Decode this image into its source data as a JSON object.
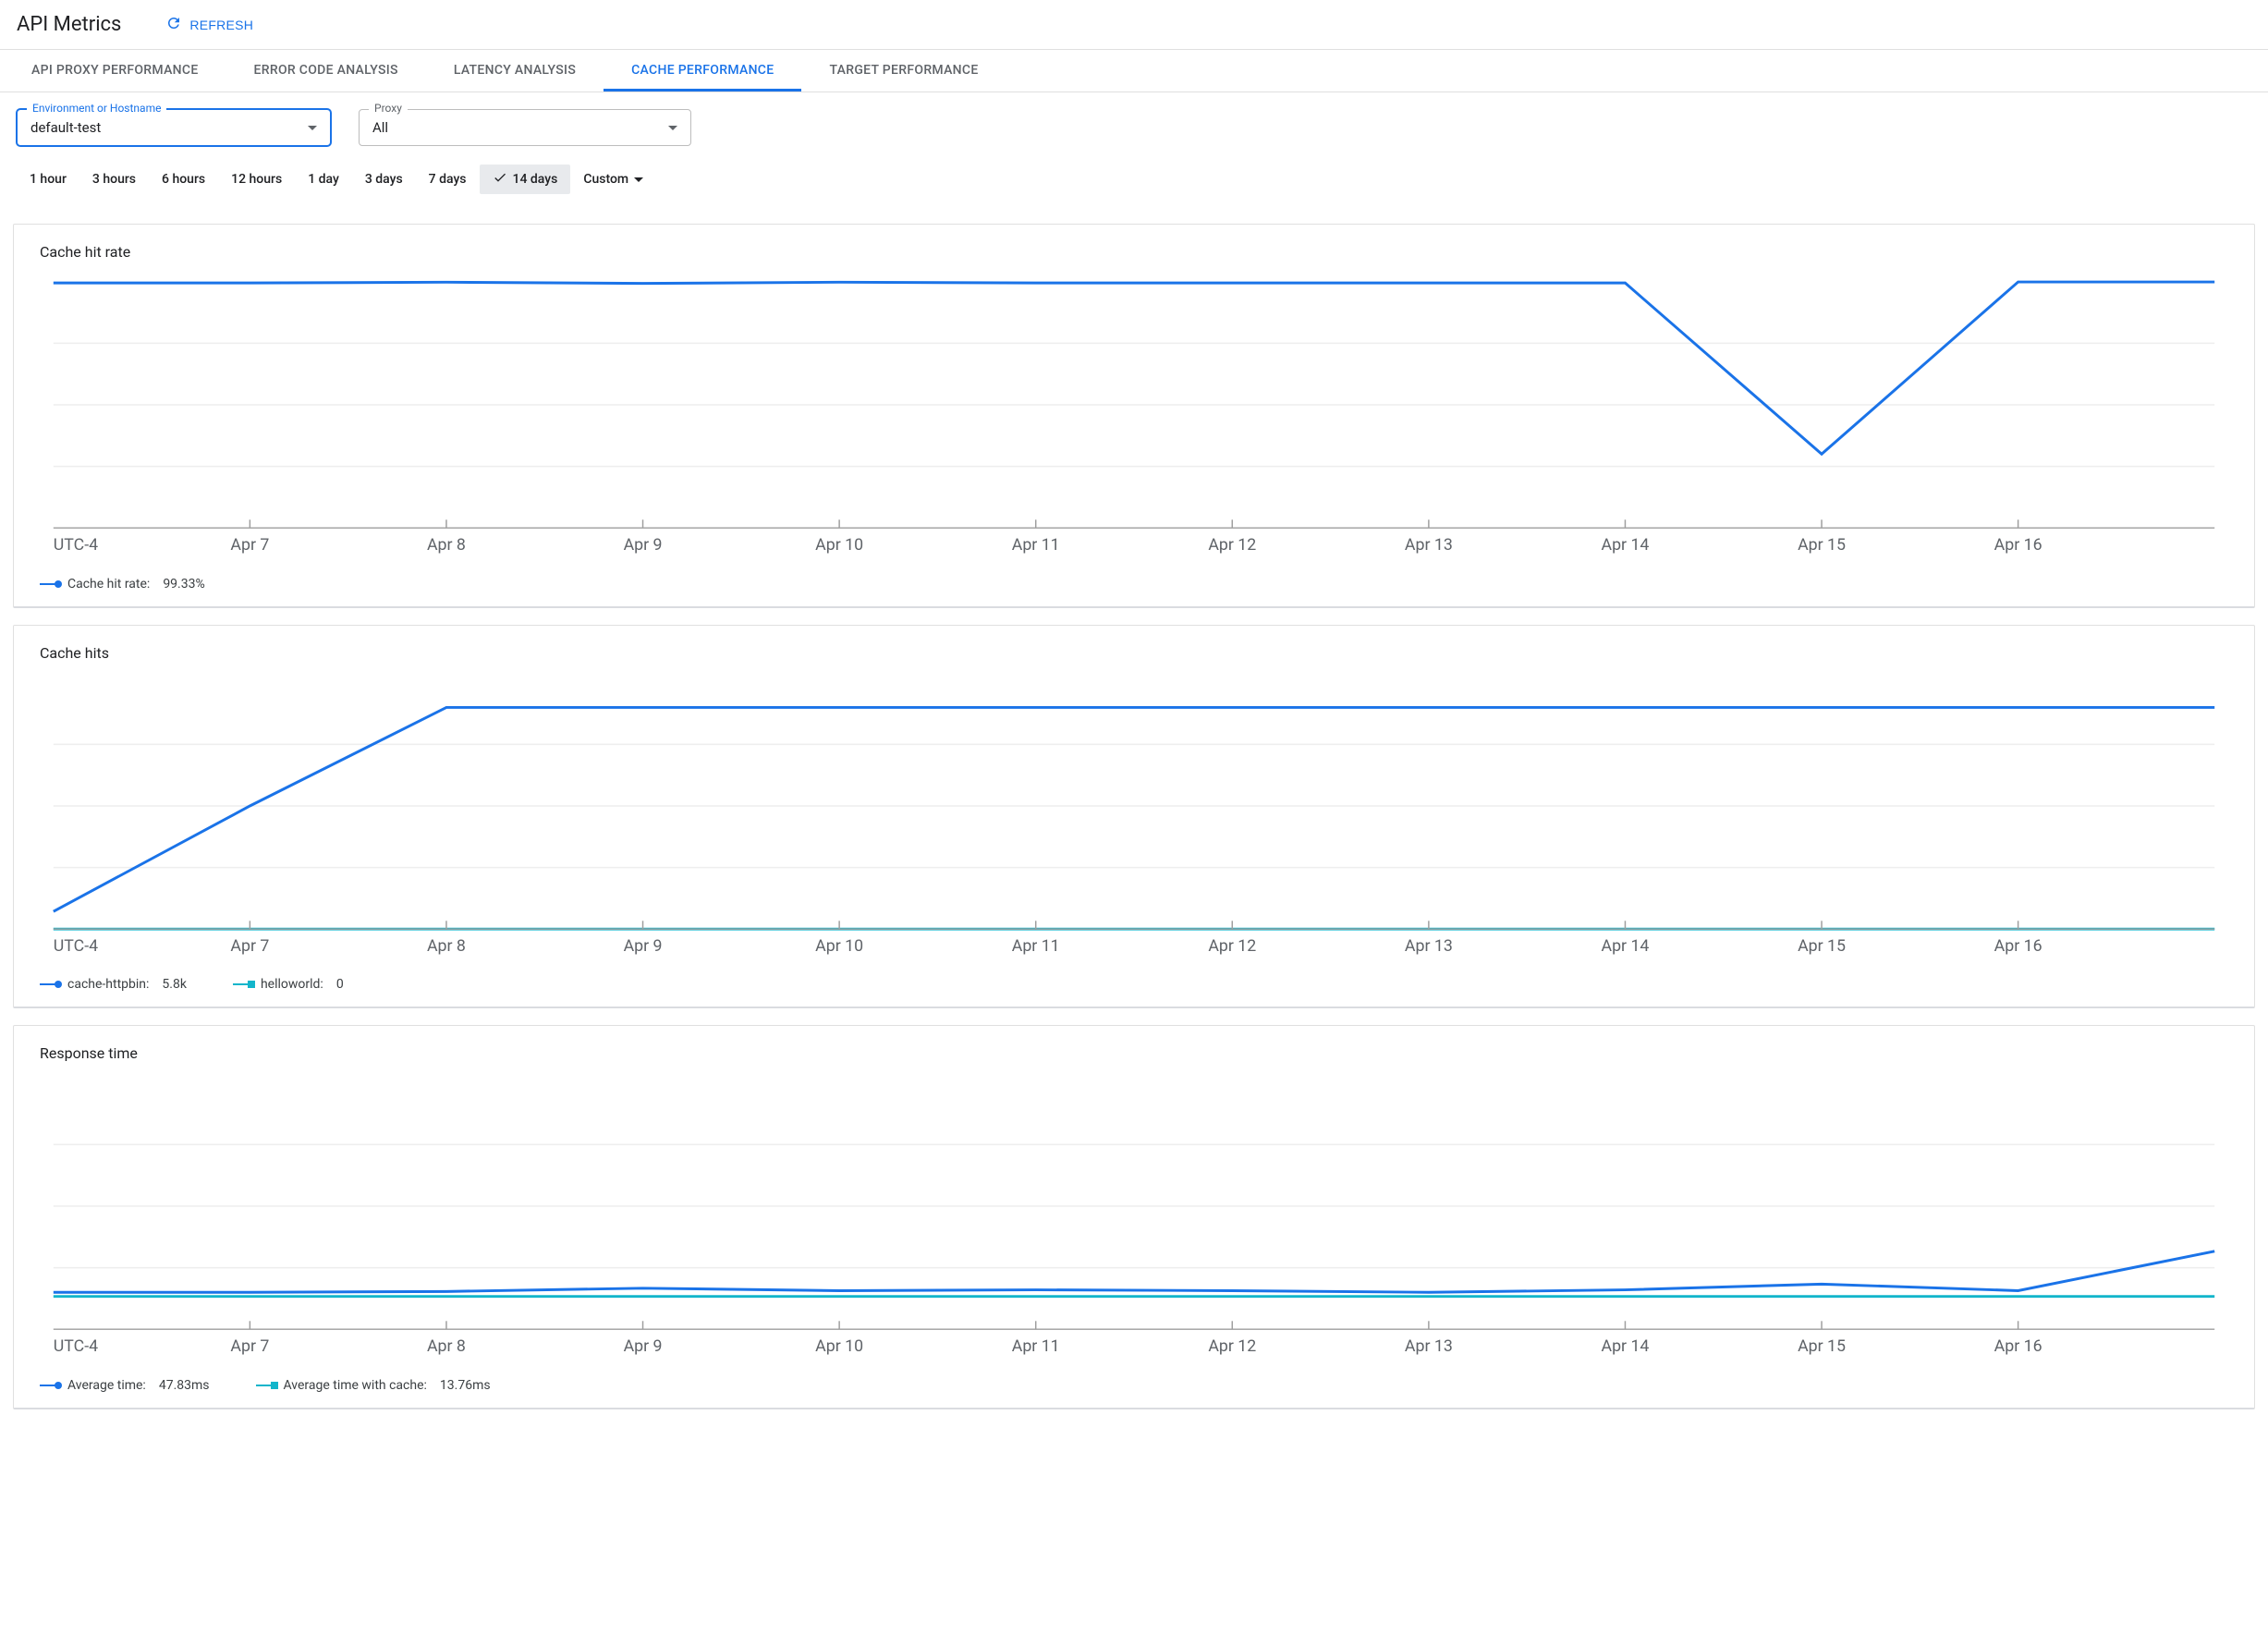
{
  "header": {
    "title": "API Metrics",
    "refresh_label": "REFRESH"
  },
  "tabs": [
    {
      "id": "api-proxy-performance",
      "label": "API PROXY PERFORMANCE",
      "active": false
    },
    {
      "id": "error-code-analysis",
      "label": "ERROR CODE ANALYSIS",
      "active": false
    },
    {
      "id": "latency-analysis",
      "label": "LATENCY ANALYSIS",
      "active": false
    },
    {
      "id": "cache-performance",
      "label": "CACHE PERFORMANCE",
      "active": true
    },
    {
      "id": "target-performance",
      "label": "TARGET PERFORMANCE",
      "active": false
    }
  ],
  "filters": {
    "environment": {
      "label": "Environment or Hostname",
      "value": "default-test"
    },
    "proxy": {
      "label": "Proxy",
      "value": "All"
    }
  },
  "time_ranges": [
    {
      "label": "1 hour"
    },
    {
      "label": "3 hours"
    },
    {
      "label": "6 hours"
    },
    {
      "label": "12 hours"
    },
    {
      "label": "1 day"
    },
    {
      "label": "3 days"
    },
    {
      "label": "7 days"
    },
    {
      "label": "14 days",
      "selected": true
    },
    {
      "label": "Custom",
      "custom": true
    }
  ],
  "time_zone_label": "UTC-4",
  "colors": {
    "blue": "#1a73e8",
    "teal": "#12b5cb"
  },
  "chart_data": [
    {
      "id": "cache-hit-rate",
      "type": "line",
      "title": "Cache hit rate",
      "xlabel": "",
      "ylabel": "",
      "ylim": [
        0,
        100
      ],
      "categories": [
        "Apr 7",
        "Apr 8",
        "Apr 9",
        "Apr 10",
        "Apr 11",
        "Apr 12",
        "Apr 13",
        "Apr 14",
        "Apr 15",
        "Apr 16"
      ],
      "x_index_start": -1,
      "series": [
        {
          "name": "Cache hit rate",
          "display_value": "99.33%",
          "color": "#1a73e8",
          "marker": "circle",
          "values": [
            99.5,
            99.5,
            99.8,
            99.3,
            99.8,
            99.5,
            99.5,
            99.5,
            99.5,
            30,
            99.9,
            99.9
          ]
        }
      ]
    },
    {
      "id": "cache-hits",
      "type": "line",
      "title": "Cache hits",
      "xlabel": "",
      "ylabel": "",
      "ylim": [
        0,
        700
      ],
      "categories": [
        "Apr 7",
        "Apr 8",
        "Apr 9",
        "Apr 10",
        "Apr 11",
        "Apr 12",
        "Apr 13",
        "Apr 14",
        "Apr 15",
        "Apr 16"
      ],
      "x_index_start": -1,
      "series": [
        {
          "name": "cache-httpbin",
          "display_value": "5.8k",
          "color": "#1a73e8",
          "marker": "circle",
          "values": [
            50,
            350,
            630,
            630,
            630,
            630,
            630,
            630,
            630,
            630,
            630,
            630
          ]
        },
        {
          "name": "helloworld",
          "display_value": "0",
          "color": "#12b5cb",
          "marker": "square",
          "values": [
            0,
            0,
            0,
            0,
            0,
            0,
            0,
            0,
            0,
            0,
            0,
            0
          ]
        }
      ]
    },
    {
      "id": "response-time",
      "type": "line",
      "title": "Response time",
      "xlabel": "",
      "ylabel": "",
      "ylim": [
        0,
        300
      ],
      "categories": [
        "Apr 7",
        "Apr 8",
        "Apr 9",
        "Apr 10",
        "Apr 11",
        "Apr 12",
        "Apr 13",
        "Apr 14",
        "Apr 15",
        "Apr 16"
      ],
      "x_index_start": -1,
      "series": [
        {
          "name": "Average time",
          "display_value": "47.83ms",
          "color": "#1a73e8",
          "marker": "circle",
          "values": [
            45,
            45,
            46,
            50,
            47,
            48,
            47,
            45,
            48,
            55,
            47,
            95
          ]
        },
        {
          "name": "Average time with cache",
          "display_value": "13.76ms",
          "color": "#12b5cb",
          "marker": "square",
          "values": [
            40,
            40,
            40,
            40,
            40,
            40,
            40,
            40,
            40,
            40,
            40,
            40
          ]
        }
      ]
    }
  ]
}
